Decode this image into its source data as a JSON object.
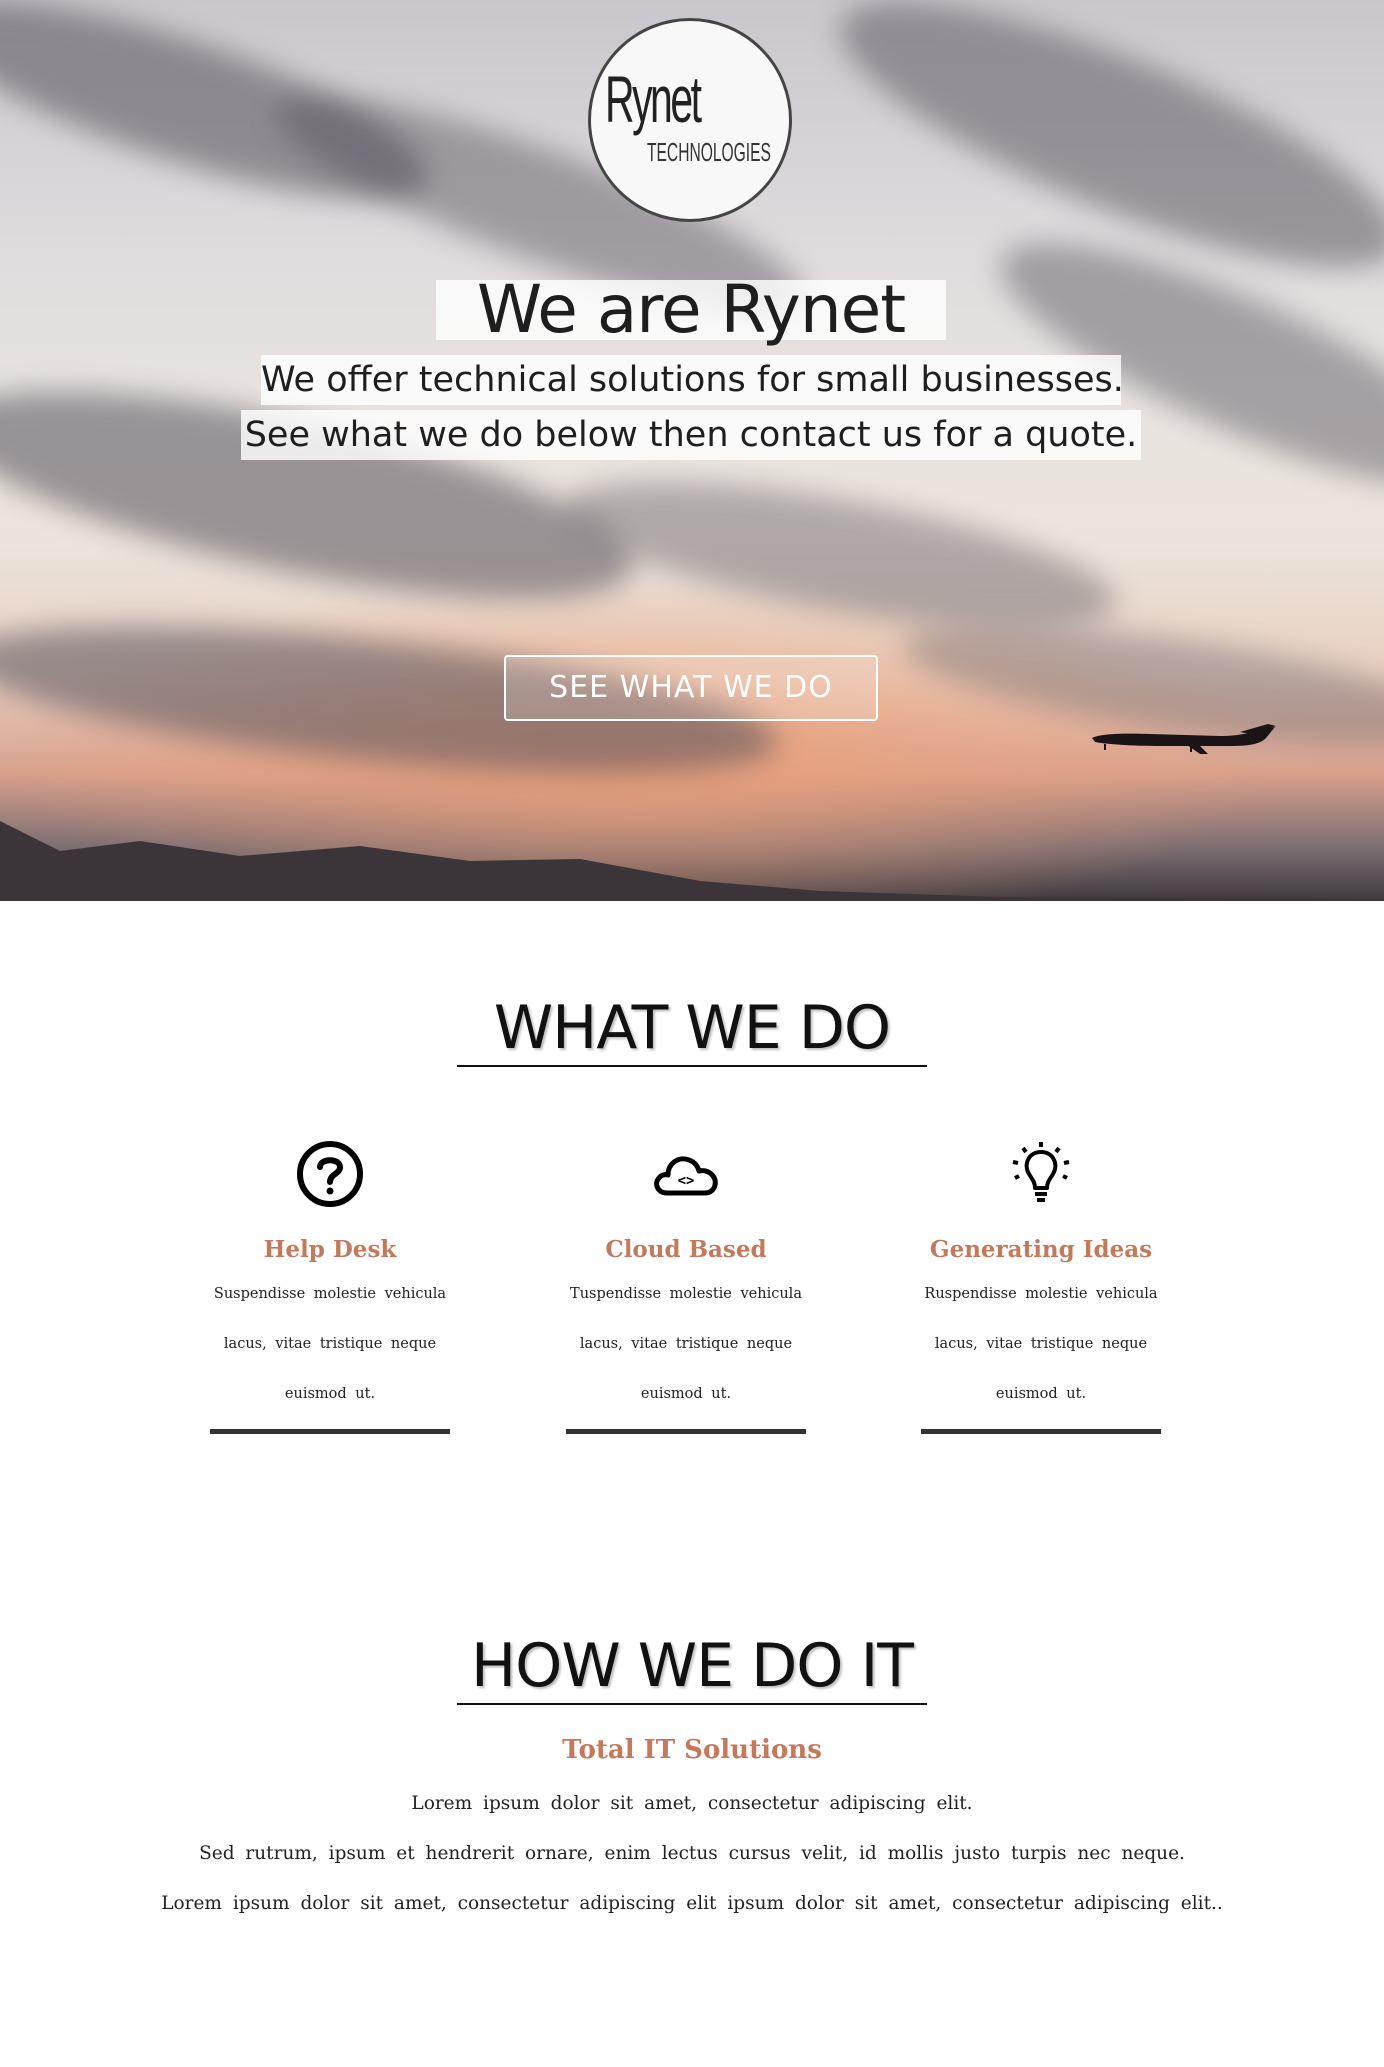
{
  "logo": {
    "main": "Rynet",
    "sub": "TECHNOLOGIES"
  },
  "hero": {
    "headline": "We are Rynet",
    "line1": "We offer technical solutions for small businesses.",
    "line2": "See what we do below then contact us for a quote.",
    "cta_label": "SEE WHAT WE DO"
  },
  "what_we_do": {
    "title": "WHAT WE DO",
    "features": [
      {
        "icon": "question-circle-icon",
        "title": "Help Desk",
        "desc": "Suspendisse molestie vehicula lacus, vitae tristique neque euismod ut."
      },
      {
        "icon": "cloud-code-icon",
        "title": "Cloud Based",
        "desc": "Tuspendisse molestie vehicula lacus, vitae tristique neque euismod ut."
      },
      {
        "icon": "lightbulb-icon",
        "title": "Generating Ideas",
        "desc": "Ruspendisse molestie vehicula lacus, vitae tristique neque euismod ut."
      }
    ]
  },
  "how_we_do_it": {
    "title": "HOW WE DO IT",
    "subtitle": "Total IT Solutions",
    "paragraphs": [
      "Lorem ipsum dolor sit amet, consectetur adipiscing elit.",
      "Sed rutrum, ipsum et hendrerit ornare, enim lectus cursus velit, id mollis justo turpis nec neque.",
      "Lorem ipsum dolor sit amet, consectetur adipiscing elit ipsum dolor sit amet, consectetur adipiscing elit.."
    ]
  },
  "colors": {
    "accent": "#c6795a",
    "text": "#222222",
    "rule": "#333333"
  }
}
